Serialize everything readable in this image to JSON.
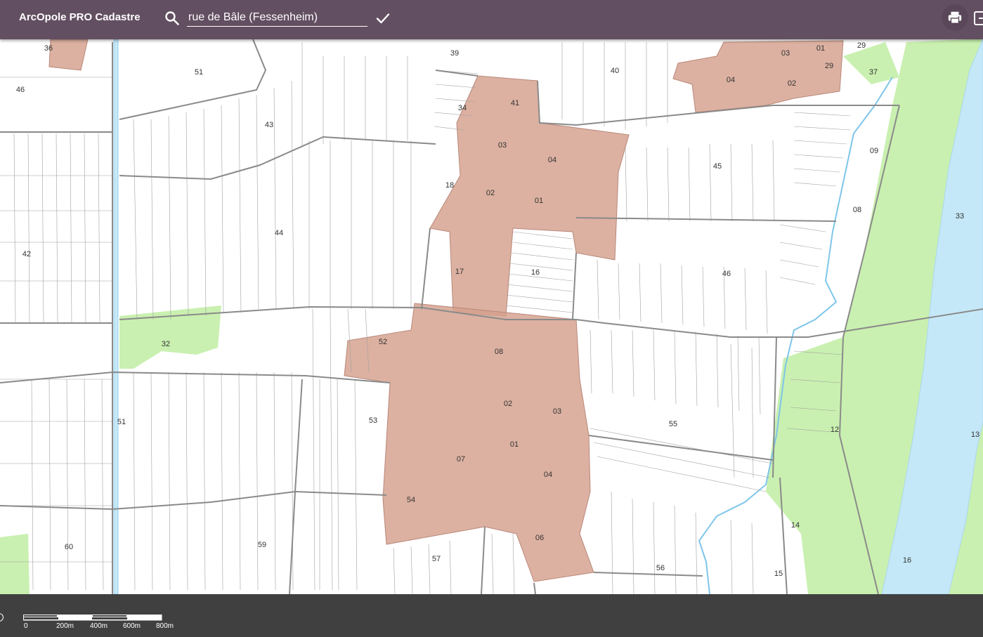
{
  "header": {
    "app_title": "ArcOpole PRO Cadastre",
    "search_value": "rue de Bâle (Fessenheim)",
    "icons": {
      "search": "search-icon",
      "confirm": "check-icon",
      "print": "print-icon",
      "export": "export-icon"
    }
  },
  "map": {
    "colors": {
      "urban": "#d4a08c",
      "green": "#c9f0b0",
      "water": "#c5e8f8",
      "river_line": "#7fc5ea",
      "section_border": "#8a8a8a",
      "parcel_line": "#999999"
    },
    "section_labels": [
      {
        "id": "l36",
        "text": "36"
      },
      {
        "id": "l46a",
        "text": "46"
      },
      {
        "id": "l51a",
        "text": "51"
      },
      {
        "id": "l43",
        "text": "43"
      },
      {
        "id": "l39",
        "text": "39"
      },
      {
        "id": "l40",
        "text": "40"
      },
      {
        "id": "l34",
        "text": "34"
      },
      {
        "id": "l41",
        "text": "41"
      },
      {
        "id": "l03a",
        "text": "03"
      },
      {
        "id": "l04a",
        "text": "04"
      },
      {
        "id": "l18",
        "text": "18"
      },
      {
        "id": "l02a",
        "text": "02"
      },
      {
        "id": "l01a",
        "text": "01"
      },
      {
        "id": "l44",
        "text": "44"
      },
      {
        "id": "l42",
        "text": "42"
      },
      {
        "id": "l17",
        "text": "17"
      },
      {
        "id": "l16a",
        "text": "16"
      },
      {
        "id": "l45",
        "text": "45"
      },
      {
        "id": "l46b",
        "text": "46"
      },
      {
        "id": "l03b",
        "text": "03"
      },
      {
        "id": "l01b",
        "text": "01"
      },
      {
        "id": "l29a",
        "text": "29"
      },
      {
        "id": "l04b",
        "text": "04"
      },
      {
        "id": "l02b",
        "text": "02"
      },
      {
        "id": "l29b",
        "text": "29"
      },
      {
        "id": "l37",
        "text": "37"
      },
      {
        "id": "l09",
        "text": "09"
      },
      {
        "id": "l08a",
        "text": "08"
      },
      {
        "id": "l33",
        "text": "33"
      },
      {
        "id": "l32",
        "text": "32"
      },
      {
        "id": "l52",
        "text": "52"
      },
      {
        "id": "l08b",
        "text": "08"
      },
      {
        "id": "l53",
        "text": "53"
      },
      {
        "id": "l51b",
        "text": "51"
      },
      {
        "id": "l02c",
        "text": "02"
      },
      {
        "id": "l03c",
        "text": "03"
      },
      {
        "id": "l55",
        "text": "55"
      },
      {
        "id": "l12",
        "text": "12"
      },
      {
        "id": "l13",
        "text": "13"
      },
      {
        "id": "l01c",
        "text": "01"
      },
      {
        "id": "l07",
        "text": "07"
      },
      {
        "id": "l04c",
        "text": "04"
      },
      {
        "id": "l54",
        "text": "54"
      },
      {
        "id": "l60",
        "text": "60"
      },
      {
        "id": "l59",
        "text": "59"
      },
      {
        "id": "l57",
        "text": "57"
      },
      {
        "id": "l06",
        "text": "06"
      },
      {
        "id": "l56",
        "text": "56"
      },
      {
        "id": "l14",
        "text": "14"
      },
      {
        "id": "l15",
        "text": "15"
      },
      {
        "id": "l16b",
        "text": "16"
      }
    ]
  },
  "footer": {
    "scale_labels": [
      "0",
      "200m",
      "400m",
      "600m",
      "800m"
    ]
  }
}
